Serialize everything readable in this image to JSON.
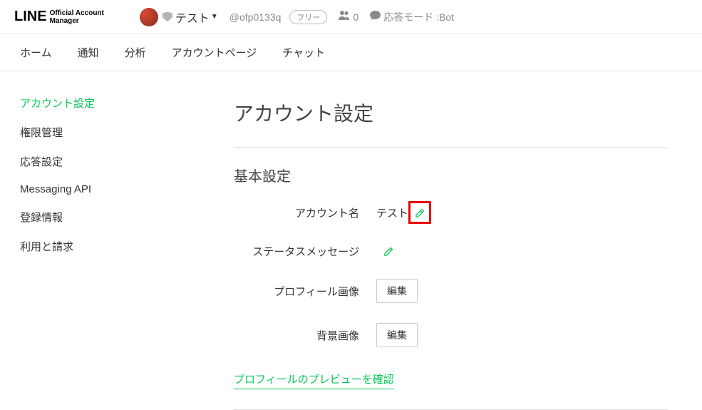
{
  "header": {
    "logo_main": "LINE",
    "logo_sub1": "Official Account",
    "logo_sub2": "Manager",
    "account_name": "テスト",
    "account_id": "@ofp0133q",
    "plan": "フリー",
    "friends_count": "0",
    "response_mode_label": "応答モード : ",
    "response_mode_value": "Bot"
  },
  "tabs": [
    "ホーム",
    "通知",
    "分析",
    "アカウントページ",
    "チャット"
  ],
  "sidebar": {
    "items": [
      "アカウント設定",
      "権限管理",
      "応答設定",
      "Messaging API",
      "登録情報",
      "利用と請求"
    ],
    "active_index": 0
  },
  "main": {
    "title": "アカウント設定",
    "section": "基本設定",
    "rows": {
      "account_name": {
        "label": "アカウント名",
        "value": "テスト"
      },
      "status_message": {
        "label": "ステータスメッセージ",
        "value": ""
      },
      "profile_image": {
        "label": "プロフィール画像",
        "button": "編集"
      },
      "bg_image": {
        "label": "背景画像",
        "button": "編集"
      }
    },
    "preview_link": "プロフィールのプレビューを確認"
  }
}
